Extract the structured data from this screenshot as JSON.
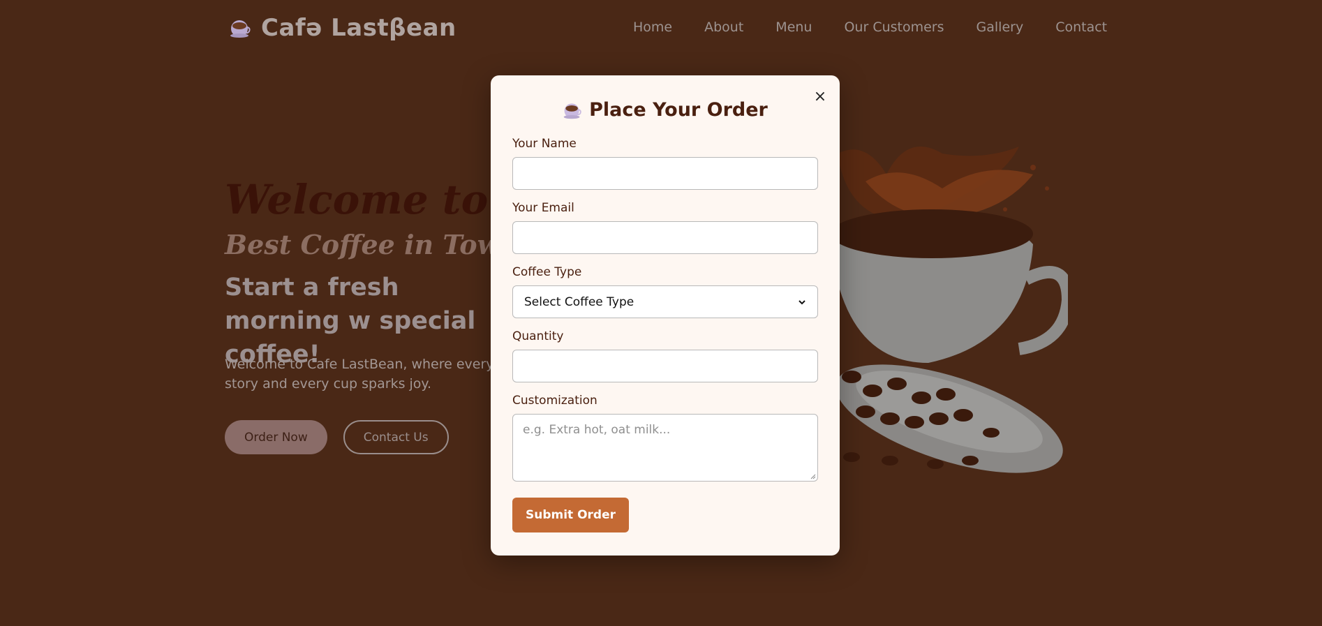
{
  "header": {
    "brand_name": "Cafə Lastβean",
    "logo_icon": "coffee-cup-icon",
    "nav": [
      "Home",
      "About",
      "Menu",
      "Our Customers",
      "Gallery",
      "Contact"
    ]
  },
  "hero": {
    "title": "Welcome to Cafe La",
    "subtitle": "Best Coffee in Town",
    "lead": "Start a fresh morning w special coffee!",
    "description": "Welcome to Cafe LastBean, where every be story and every cup sparks joy.",
    "order_button": "Order Now",
    "contact_button": "Contact Us",
    "image_icon": "coffee-splash-cup-image"
  },
  "modal": {
    "title": "Place Your Order",
    "title_icon": "coffee-cup-icon",
    "close_label": "×",
    "name_label": "Your Name",
    "name_value": "",
    "email_label": "Your Email",
    "email_value": "",
    "coffee_label": "Coffee Type",
    "coffee_selected": "Select Coffee Type",
    "quantity_label": "Quantity",
    "quantity_value": "",
    "custom_label": "Customization",
    "custom_placeholder": "e.g. Extra hot, oat milk...",
    "submit_label": "Submit Order"
  },
  "colors": {
    "background": "#4a2816",
    "modal_bg": "#fef7f2",
    "accent": "#c46a34",
    "heading": "#4a2010"
  }
}
